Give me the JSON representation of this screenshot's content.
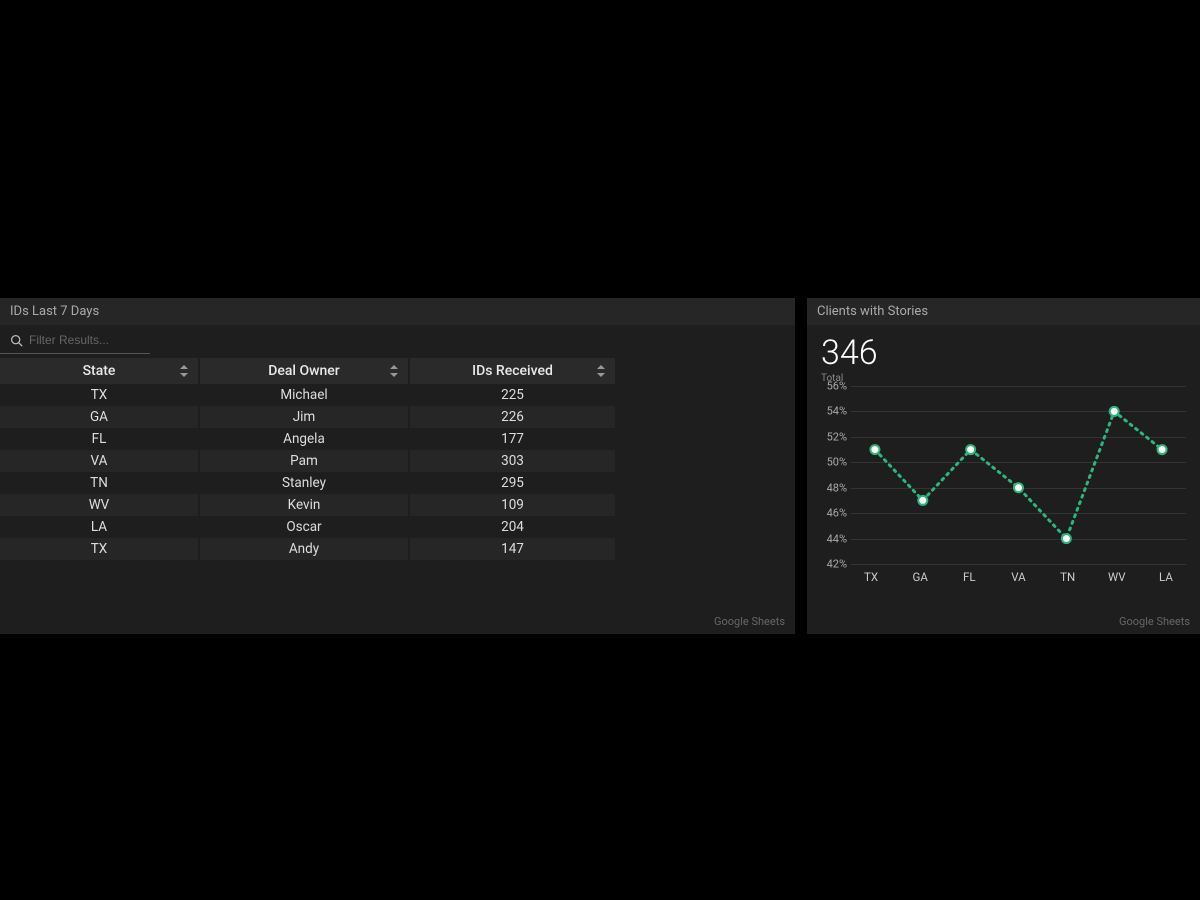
{
  "left": {
    "title": "IDs Last 7 Days",
    "filter_placeholder": "Filter Results...",
    "columns": [
      "State",
      "Deal Owner",
      "IDs Received"
    ],
    "rows": [
      {
        "state": "TX",
        "owner": "Michael",
        "ids": "225"
      },
      {
        "state": "GA",
        "owner": "Jim",
        "ids": "226"
      },
      {
        "state": "FL",
        "owner": "Angela",
        "ids": "177"
      },
      {
        "state": "VA",
        "owner": "Pam",
        "ids": "303"
      },
      {
        "state": "TN",
        "owner": "Stanley",
        "ids": "295"
      },
      {
        "state": "WV",
        "owner": "Kevin",
        "ids": "109"
      },
      {
        "state": "LA",
        "owner": "Oscar",
        "ids": "204"
      },
      {
        "state": "TX",
        "owner": "Andy",
        "ids": "147"
      }
    ],
    "footer": "Google Sheets"
  },
  "right": {
    "title": "Clients with Stories",
    "big_number": "346",
    "big_label": "Total",
    "footer": "Google Sheets"
  },
  "chart_data": {
    "type": "line",
    "categories": [
      "TX",
      "GA",
      "FL",
      "VA",
      "TN",
      "WV",
      "LA"
    ],
    "values": [
      51,
      47,
      51,
      48,
      44,
      54,
      51
    ],
    "y_ticks": [
      "56%",
      "54%",
      "52%",
      "50%",
      "48%",
      "46%",
      "44%",
      "42%"
    ],
    "ylim": [
      42,
      56
    ],
    "line_color": "#2cb67d",
    "point_fill": "#ffffff",
    "line_style": "dotted"
  }
}
